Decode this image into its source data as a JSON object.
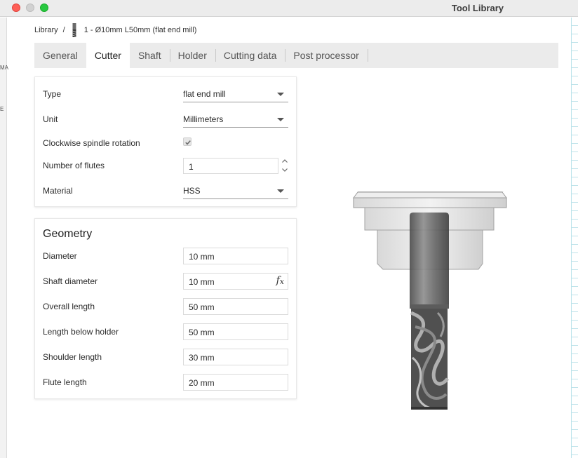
{
  "window": {
    "title": "Tool Library"
  },
  "edges": {
    "left_fragments": [
      "MA",
      "E"
    ]
  },
  "breadcrumb": {
    "root": "Library",
    "separator": "/",
    "current": "1 - Ø10mm L50mm (flat end mill)"
  },
  "tabs": [
    {
      "label": "General"
    },
    {
      "label": "Cutter",
      "active": true
    },
    {
      "label": "Shaft"
    },
    {
      "label": "Holder"
    },
    {
      "label": "Cutting data"
    },
    {
      "label": "Post processor"
    }
  ],
  "cutter": {
    "type": {
      "label": "Type",
      "value": "flat end mill"
    },
    "unit": {
      "label": "Unit",
      "value": "Millimeters"
    },
    "clockwise": {
      "label": "Clockwise spindle rotation",
      "checked": true
    },
    "flutes": {
      "label": "Number of flutes",
      "value": "1"
    },
    "material": {
      "label": "Material",
      "value": "HSS"
    }
  },
  "geometry": {
    "title": "Geometry",
    "fields": [
      {
        "label": "Diameter",
        "value": "10 mm"
      },
      {
        "label": "Shaft diameter",
        "value": "10 mm",
        "expression_icon": "fx"
      },
      {
        "label": "Overall length",
        "value": "50 mm"
      },
      {
        "label": "Length below holder",
        "value": "50 mm"
      },
      {
        "label": "Shoulder length",
        "value": "30 mm"
      },
      {
        "label": "Flute length",
        "value": "20 mm"
      }
    ]
  },
  "icons": {
    "breadcrumb_tool": "end-mill-icon",
    "dropdown": "chevron-down-icon",
    "checkmark": "checkmark-icon",
    "stepper": "stepper-icon",
    "expression": "fx-icon"
  },
  "colors": {
    "window_red": "#fe5f57",
    "window_gray": "#d1d1d1",
    "window_green": "#28c840",
    "tab_bar": "#ebebeb"
  }
}
